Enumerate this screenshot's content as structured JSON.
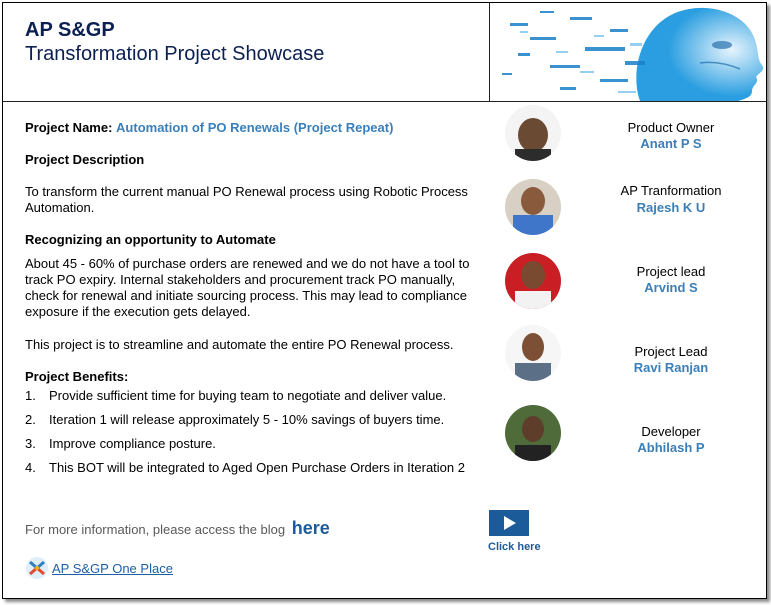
{
  "header": {
    "title": "AP S&GP",
    "subtitle": "Transformation Project Showcase"
  },
  "project": {
    "name_label": "Project Name:",
    "name_value": "Automation of PO Renewals (Project Repeat)",
    "description_heading": "Project Description",
    "description_text": "To transform the current manual PO Renewal process using Robotic Process Automation.",
    "opportunity_heading": "Recognizing an opportunity to Automate",
    "opportunity_text": "About 45 - 60% of purchase orders are renewed and we do not have a tool to track PO expiry. Internal stakeholders and procurement track PO manually, check for renewal and initiate sourcing process. This may lead to compliance exposure if the execution gets delayed.",
    "streamline_text": "This project is to streamline and automate the entire PO Renewal process.",
    "benefits_heading": "Project Benefits:",
    "benefits": [
      {
        "num": "1.",
        "text": "Provide sufficient time for buying team to negotiate and deliver value."
      },
      {
        "num": "2.",
        "text": "Iteration 1 will release approximately 5 - 10% savings of buyers time."
      },
      {
        "num": "3.",
        "text": "Improve compliance posture."
      },
      {
        "num": "4.",
        "text": "This BOT will be integrated to Aged Open Purchase Orders in Iteration 2"
      }
    ]
  },
  "footer": {
    "more_info_text": "For more information, please access the blog",
    "here_link": "here",
    "click_here": "Click here",
    "one_place_link": "AP S&GP One Place"
  },
  "team": [
    {
      "role": "Product Owner",
      "name": "Anant P S"
    },
    {
      "role": "AP Tranformation",
      "name": "Rajesh K U"
    },
    {
      "role": "Project lead",
      "name": "Arvind S"
    },
    {
      "role": "Project Lead",
      "name": "Ravi Ranjan"
    },
    {
      "role": "Developer",
      "name": "Abhilash P"
    }
  ],
  "colors": {
    "title_navy": "#0b1f52",
    "accent_blue": "#3a7fb9",
    "link_blue": "#1c5b99"
  },
  "icons": {
    "play": "play-icon",
    "one_place": "one-place-logo-icon"
  }
}
